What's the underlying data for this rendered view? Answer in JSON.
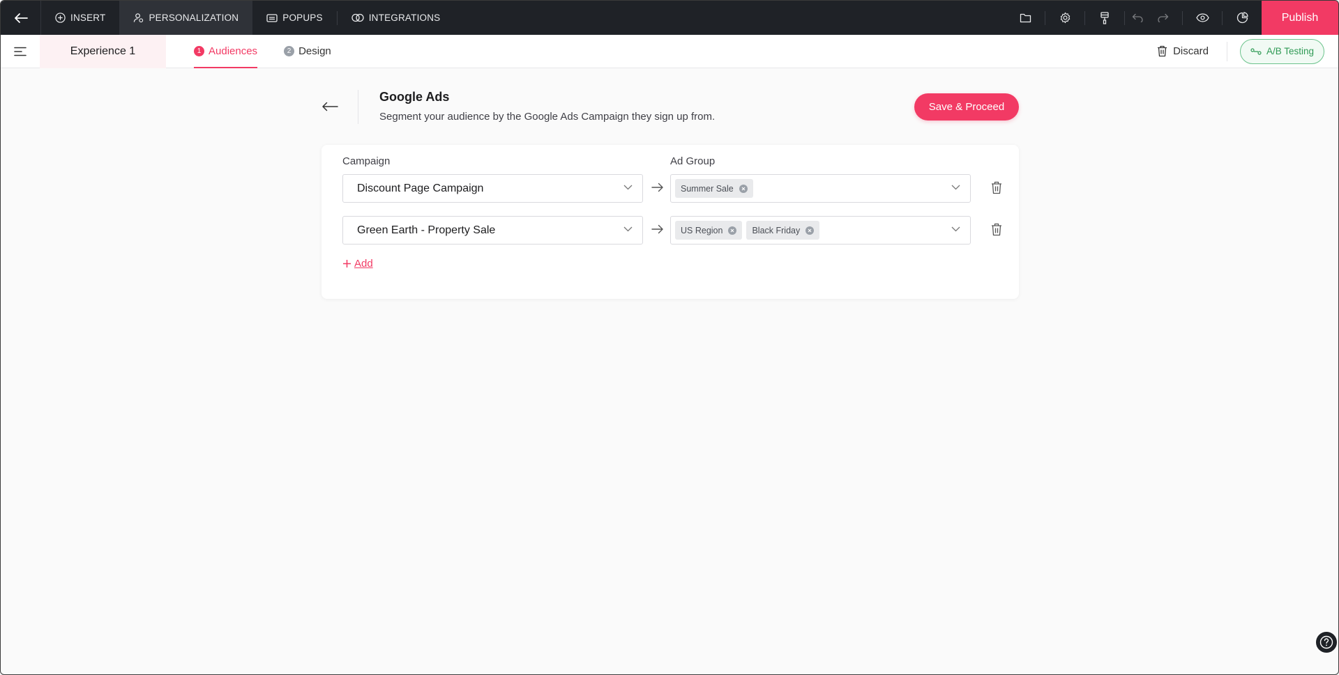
{
  "topbar": {
    "nav": [
      {
        "label": "INSERT",
        "icon": "plus-circle-icon"
      },
      {
        "label": "PERSONALIZATION",
        "icon": "personalization-icon"
      },
      {
        "label": "POPUPS",
        "icon": "popup-icon"
      },
      {
        "label": "INTEGRATIONS",
        "icon": "integrations-icon"
      }
    ],
    "active_nav": "PERSONALIZATION",
    "publish_label": "Publish",
    "right_icons": [
      "folder-icon",
      "gear-icon",
      "paint-brush-icon",
      "undo-icon",
      "redo-icon",
      "eye-icon",
      "analytics-icon"
    ]
  },
  "subbar": {
    "experience_name": "Experience 1",
    "steps": [
      {
        "num": "1",
        "label": "Audiences",
        "active": true
      },
      {
        "num": "2",
        "label": "Design",
        "active": false
      }
    ],
    "discard_label": "Discard",
    "ab_testing_label": "A/B Testing"
  },
  "header": {
    "title": "Google Ads",
    "subtitle": "Segment your audience by the Google Ads Campaign they sign up from.",
    "save_label": "Save & Proceed"
  },
  "mapping": {
    "campaign_label": "Campaign",
    "ad_group_label": "Ad Group",
    "rows": [
      {
        "campaign": "Discount Page Campaign",
        "ad_groups": [
          "Summer Sale"
        ]
      },
      {
        "campaign": "Green Earth - Property Sale",
        "ad_groups": [
          "US Region",
          "Black Friday"
        ]
      }
    ],
    "add_label": "Add"
  },
  "colors": {
    "accent": "#f23a64",
    "topbar_bg": "#1f2227",
    "ab_green": "#2f9a55"
  }
}
